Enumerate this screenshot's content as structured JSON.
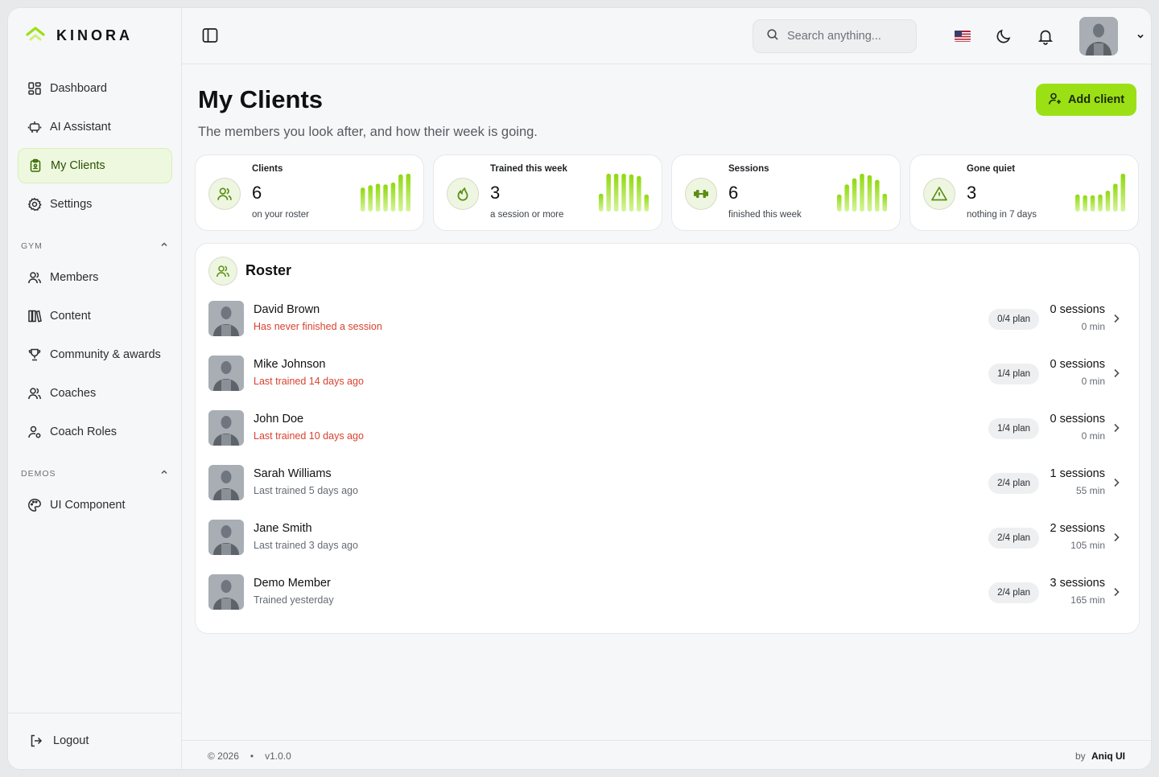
{
  "brand": {
    "name": "KINORA",
    "accent": "#9be015"
  },
  "sidebar": {
    "items": [
      {
        "label": "Dashboard",
        "icon": "dashboard-icon"
      },
      {
        "label": "AI Assistant",
        "icon": "robot-icon"
      },
      {
        "label": "My Clients",
        "icon": "clipboard-icon",
        "active": true
      },
      {
        "label": "Settings",
        "icon": "gear-icon"
      }
    ],
    "gym_section": "GYM",
    "gym_items": [
      {
        "label": "Members",
        "icon": "users-icon"
      },
      {
        "label": "Content",
        "icon": "library-icon"
      },
      {
        "label": "Community & awards",
        "icon": "trophy-icon"
      },
      {
        "label": "Coaches",
        "icon": "users-icon"
      },
      {
        "label": "Coach Roles",
        "icon": "user-cog-icon"
      }
    ],
    "demos_section": "DEMOS",
    "demos_items": [
      {
        "label": "UI Component",
        "icon": "palette-icon"
      }
    ],
    "logout": "Logout"
  },
  "header": {
    "search_placeholder": "Search anything..."
  },
  "page": {
    "title": "My Clients",
    "subtitle": "The members you look after, and how their week is going.",
    "add_button": "Add client"
  },
  "stats": [
    {
      "label": "Clients",
      "value": "6",
      "note": "on your roster",
      "icon": "users-icon",
      "bars": [
        0.62,
        0.68,
        0.72,
        0.7,
        0.75,
        0.96,
        0.98
      ]
    },
    {
      "label": "Trained this week",
      "value": "3",
      "note": "a session or more",
      "icon": "flame-icon",
      "bars": [
        0.46,
        0.98,
        0.98,
        0.98,
        0.96,
        0.92,
        0.44
      ]
    },
    {
      "label": "Sessions",
      "value": "6",
      "note": "finished this week",
      "icon": "dumbbell-icon",
      "bars": [
        0.44,
        0.7,
        0.86,
        0.98,
        0.94,
        0.82,
        0.46
      ]
    },
    {
      "label": "Gone quiet",
      "value": "3",
      "note": "nothing in 7 days",
      "icon": "warning-icon",
      "bars": [
        0.44,
        0.42,
        0.42,
        0.44,
        0.54,
        0.72,
        0.98
      ]
    }
  ],
  "roster": {
    "title": "Roster",
    "rows": [
      {
        "name": "David Brown",
        "status": "Has never finished a session",
        "warn": true,
        "plan": "0/4 plan",
        "sessions": "0 sessions",
        "minutes": "0 min"
      },
      {
        "name": "Mike Johnson",
        "status": "Last trained 14 days ago",
        "warn": true,
        "plan": "1/4 plan",
        "sessions": "0 sessions",
        "minutes": "0 min"
      },
      {
        "name": "John Doe",
        "status": "Last trained 10 days ago",
        "warn": true,
        "plan": "1/4 plan",
        "sessions": "0 sessions",
        "minutes": "0 min"
      },
      {
        "name": "Sarah Williams",
        "status": "Last trained 5 days ago",
        "warn": false,
        "plan": "2/4 plan",
        "sessions": "1 sessions",
        "minutes": "55 min"
      },
      {
        "name": "Jane Smith",
        "status": "Last trained 3 days ago",
        "warn": false,
        "plan": "2/4 plan",
        "sessions": "2 sessions",
        "minutes": "105 min"
      },
      {
        "name": "Demo Member",
        "status": "Trained yesterday",
        "warn": false,
        "plan": "2/4 plan",
        "sessions": "3 sessions",
        "minutes": "165 min"
      }
    ]
  },
  "footer": {
    "copyright": "© 2026",
    "separator": "•",
    "version": "v1.0.0",
    "by": "by",
    "author": "Aniq UI"
  }
}
